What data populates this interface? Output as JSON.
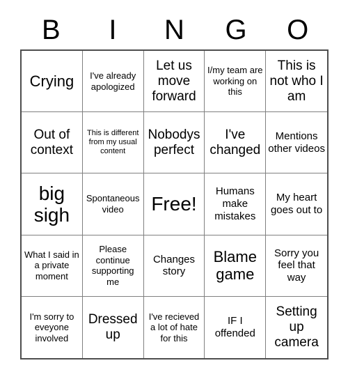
{
  "card": {
    "type": "bingo-card",
    "columns": 5,
    "rows": 5,
    "header_letters": [
      "B",
      "I",
      "N",
      "G",
      "O"
    ],
    "free_space": {
      "label": "Free!",
      "row": 3,
      "column": 3
    },
    "cells": [
      {
        "text": "Crying",
        "size": "fs-xl"
      },
      {
        "text": "I've already apologized",
        "size": "fs-s"
      },
      {
        "text": "Let us move forward",
        "size": "fs-l"
      },
      {
        "text": "I/my team are working on this",
        "size": "fs-s"
      },
      {
        "text": "This is not who I am",
        "size": "fs-l"
      },
      {
        "text": "Out of context",
        "size": "fs-l"
      },
      {
        "text": "This is different from my usual content",
        "size": "fs-xs"
      },
      {
        "text": "Nobodys perfect",
        "size": "fs-l"
      },
      {
        "text": "I've changed",
        "size": "fs-l"
      },
      {
        "text": "Mentions other videos",
        "size": "fs-m"
      },
      {
        "text": "big sigh",
        "size": "fs-xxl"
      },
      {
        "text": "Spontaneous video",
        "size": "fs-s"
      },
      {
        "text": "Free!",
        "size": "fs-xxl"
      },
      {
        "text": "Humans make mistakes",
        "size": "fs-m"
      },
      {
        "text": "My heart goes out to",
        "size": "fs-m"
      },
      {
        "text": "What I said in a private moment",
        "size": "fs-s"
      },
      {
        "text": "Please continue supporting me",
        "size": "fs-s"
      },
      {
        "text": "Changes story",
        "size": "fs-m"
      },
      {
        "text": "Blame game",
        "size": "fs-xl"
      },
      {
        "text": "Sorry you feel that way",
        "size": "fs-m"
      },
      {
        "text": "I'm sorry to eveyone involved",
        "size": "fs-s"
      },
      {
        "text": "Dressed up",
        "size": "fs-l"
      },
      {
        "text": "I've recieved a lot of hate for this",
        "size": "fs-s"
      },
      {
        "text": "IF I offended",
        "size": "fs-m"
      },
      {
        "text": "Setting up camera",
        "size": "fs-l"
      }
    ]
  },
  "colors": {
    "background": "#ffffff",
    "text": "#000000",
    "inner_border": "#808080",
    "outer_border": "#4d4d4d"
  }
}
